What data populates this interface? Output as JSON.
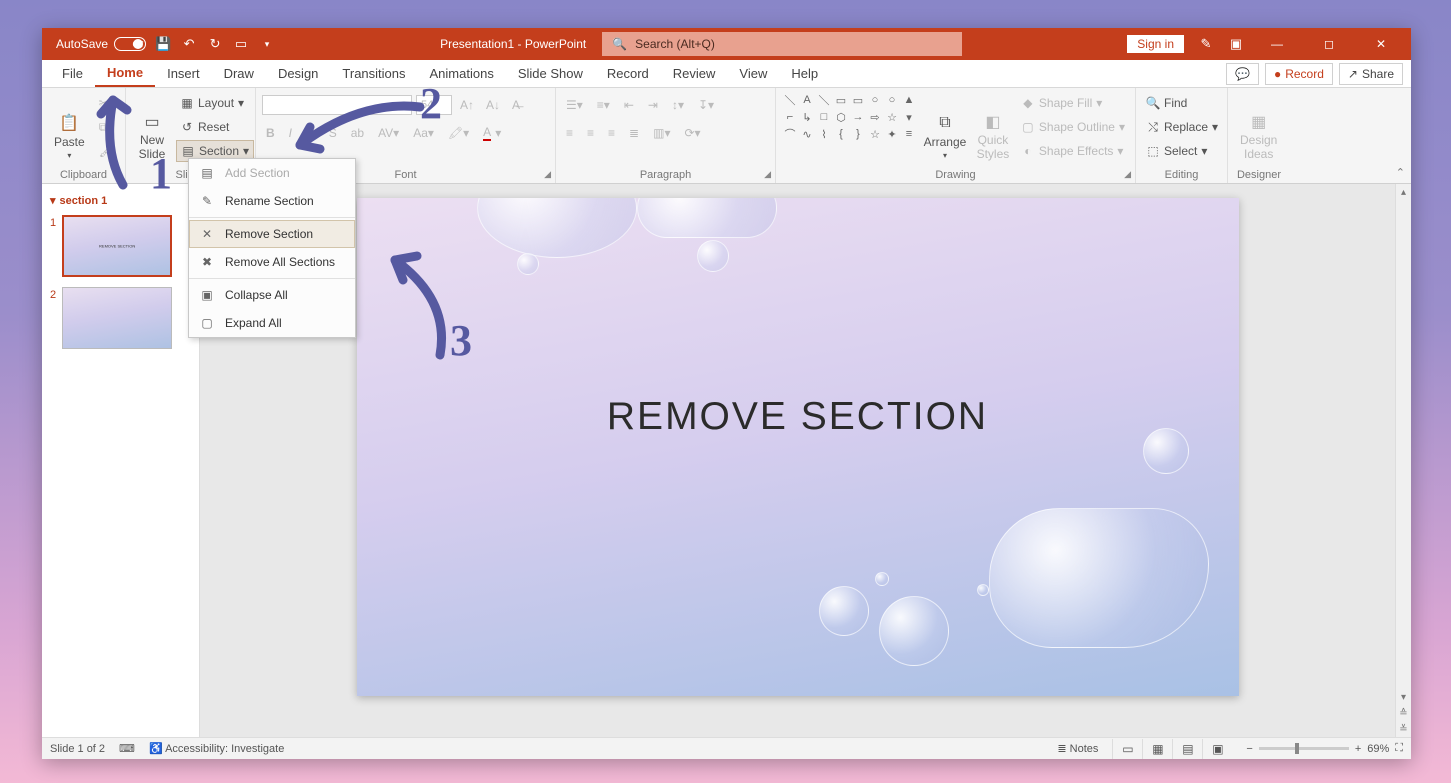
{
  "titlebar": {
    "autosave_label": "AutoSave",
    "autosave_state": "Off",
    "doc_title": "Presentation1 - PowerPoint",
    "search_placeholder": "Search (Alt+Q)",
    "signin": "Sign in"
  },
  "tabs": {
    "file": "File",
    "home": "Home",
    "insert": "Insert",
    "draw": "Draw",
    "design": "Design",
    "transitions": "Transitions",
    "animations": "Animations",
    "slideshow": "Slide Show",
    "record": "Record",
    "review": "Review",
    "view": "View",
    "help": "Help",
    "record_btn": "Record",
    "share_btn": "Share"
  },
  "ribbon": {
    "clipboard": {
      "paste": "Paste",
      "label": "Clipboard"
    },
    "slides": {
      "new_slide": "New\nSlide",
      "layout": "Layout",
      "reset": "Reset",
      "section": "Section",
      "label": "Slides"
    },
    "font": {
      "size": "54",
      "label": "Font"
    },
    "paragraph": {
      "label": "Paragraph"
    },
    "drawing": {
      "arrange": "Arrange",
      "quick": "Quick\nStyles",
      "shape_fill": "Shape Fill",
      "shape_outline": "Shape Outline",
      "shape_effects": "Shape Effects",
      "label": "Drawing"
    },
    "editing": {
      "find": "Find",
      "replace": "Replace",
      "select": "Select",
      "label": "Editing"
    },
    "designer": {
      "design_ideas": "Design\nIdeas",
      "label": "Designer"
    }
  },
  "section_menu": {
    "add": "Add Section",
    "rename": "Rename Section",
    "remove": "Remove Section",
    "remove_all": "Remove All Sections",
    "collapse": "Collapse All",
    "expand": "Expand All"
  },
  "thumbnails": {
    "section_name": "section 1",
    "slide1_num": "1",
    "slide2_num": "2",
    "mini_title": "REMOVE SECTION"
  },
  "slide": {
    "title": "REMOVE SECTION"
  },
  "statusbar": {
    "slide_count": "Slide 1 of 2",
    "accessibility": "Accessibility: Investigate",
    "notes": "Notes",
    "zoom": "69%"
  },
  "annotations": {
    "n1": "1",
    "n2": "2",
    "n3": "3"
  }
}
